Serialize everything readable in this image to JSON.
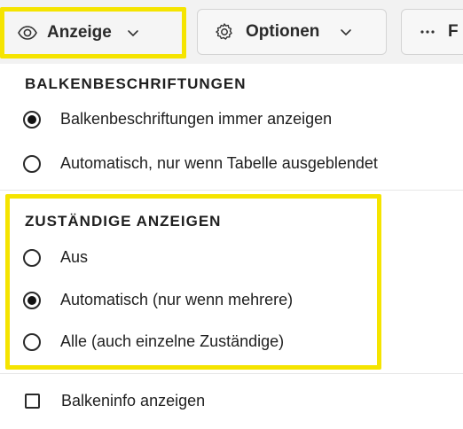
{
  "toolbar": {
    "display_label": "Anzeige",
    "options_label": "Optionen",
    "more_label": "F"
  },
  "sections": {
    "bar_labels": {
      "title": "BALKENBESCHRIFTUNGEN",
      "options": [
        {
          "label": "Balkenbeschriftungen immer anzeigen",
          "checked": true
        },
        {
          "label": "Automatisch, nur wenn Tabelle ausgeblendet",
          "checked": false
        }
      ]
    },
    "assignees": {
      "title": "ZUSTÄNDIGE ANZEIGEN",
      "options": [
        {
          "label": "Aus",
          "checked": false
        },
        {
          "label": "Automatisch (nur wenn mehrere)",
          "checked": true
        },
        {
          "label": "Alle (auch einzelne Zuständige)",
          "checked": false
        }
      ]
    },
    "bar_info": {
      "label": "Balkeninfo anzeigen",
      "checked": false
    }
  },
  "colors": {
    "highlight": "#f5e400",
    "panel_bg": "#ffffff",
    "toolbar_bg": "#f2f2f2"
  },
  "icons": {
    "display": "eye-icon",
    "options": "gear-icon",
    "more": "ellipsis-icon",
    "dropdown": "chevron-down-icon"
  }
}
